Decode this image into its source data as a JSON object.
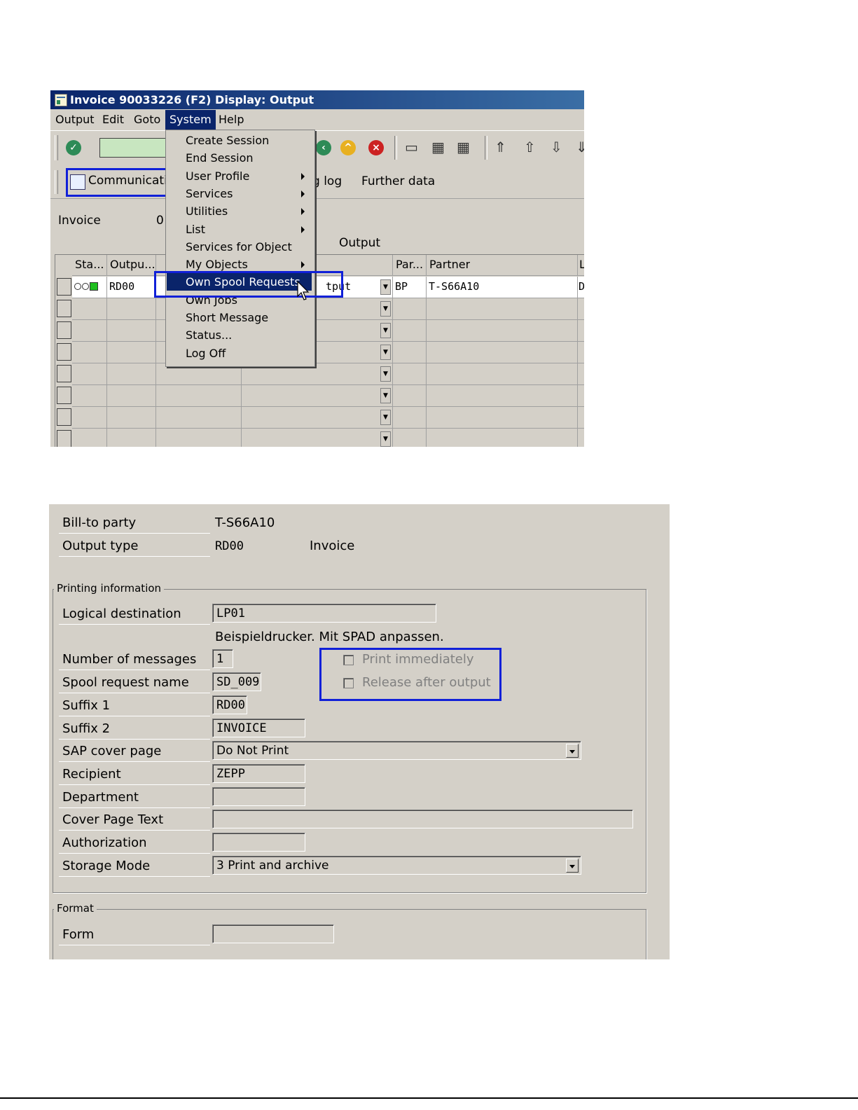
{
  "window": {
    "title": "Invoice 90033226  (F2) Display: Output"
  },
  "menubar": {
    "items": [
      "Output",
      "Edit",
      "Goto",
      "System",
      "Help"
    ]
  },
  "appbar": {
    "communication_label": "Communication",
    "processing_log_label": "g log",
    "further_data_label": "Further data"
  },
  "header": {
    "invoice_label": "Invoice",
    "invoice_value": "0",
    "output_group_label": "Output"
  },
  "table": {
    "columns": [
      "Sta...",
      "Outpu...",
      "",
      "",
      "Par...",
      "Partner",
      "L"
    ],
    "rows": [
      {
        "status": "OO",
        "output_type": "RD00",
        "medium": "tput",
        "partner_function": "BP",
        "partner": "T-S66A10",
        "lang": "D"
      }
    ]
  },
  "system_menu": {
    "items": [
      {
        "label": "Create Session",
        "submenu": false
      },
      {
        "label": "End Session",
        "submenu": false
      },
      {
        "label": "User Profile",
        "submenu": true
      },
      {
        "label": "Services",
        "submenu": true
      },
      {
        "label": "Utilities",
        "submenu": true
      },
      {
        "label": "List",
        "submenu": true
      },
      {
        "label": "Services for Object",
        "submenu": false
      },
      {
        "label": "My Objects",
        "submenu": true
      },
      {
        "label": "Own Spool Requests",
        "submenu": false,
        "highlighted": true
      },
      {
        "label": "Own Jobs",
        "submenu": false
      },
      {
        "label": "Short Message",
        "submenu": false
      },
      {
        "label": "Status...",
        "submenu": false
      },
      {
        "label": "Log Off",
        "submenu": false
      }
    ]
  },
  "detail": {
    "bill_to_party_label": "Bill-to party",
    "bill_to_party_value": "T-S66A10",
    "output_type_label": "Output type",
    "output_type_value": "RD00",
    "output_type_desc": "Invoice",
    "printing_group_title": "Printing information",
    "logical_destination_label": "Logical destination",
    "logical_destination_value": "LP01",
    "destination_desc": "Beispieldrucker. Mit SPAD anpassen.",
    "number_of_messages_label": "Number of messages",
    "number_of_messages_value": "1",
    "print_immediately_label": "Print immediately",
    "print_immediately_checked": false,
    "release_after_output_label": "Release after output",
    "release_after_output_checked": false,
    "spool_request_name_label": "Spool request name",
    "spool_request_name_value": "SD_009",
    "suffix1_label": "Suffix 1",
    "suffix1_value": "RD00",
    "suffix2_label": "Suffix 2",
    "suffix2_value": "INVOICE",
    "sap_cover_page_label": "SAP cover page",
    "sap_cover_page_value": "Do Not Print",
    "recipient_label": "Recipient",
    "recipient_value": "ZEPP",
    "department_label": "Department",
    "department_value": "",
    "cover_page_text_label": "Cover Page Text",
    "cover_page_text_value": "",
    "authorization_label": "Authorization",
    "authorization_value": "",
    "storage_mode_label": "Storage Mode",
    "storage_mode_value": "3 Print and archive",
    "format_group_title": "Format",
    "form_label": "Form",
    "form_value": ""
  },
  "colors": {
    "highlight_box": "#1020d8",
    "titlebar": "#0a246a",
    "sap_gray": "#d4d0c8"
  }
}
